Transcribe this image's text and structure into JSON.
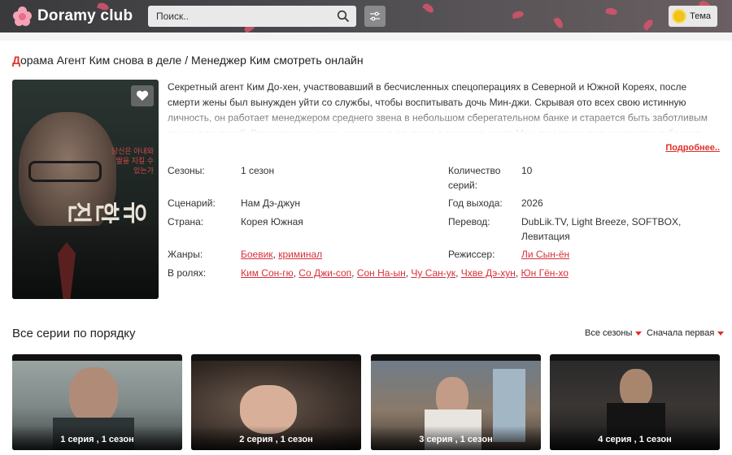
{
  "header": {
    "site_name": "Doramy club",
    "search_placeholder": "Поиск..",
    "theme_label": "Тема"
  },
  "page": {
    "title_first_letter": "Д",
    "title_rest": "орама Агент Ким снова в деле / Менеджер Ким смотреть онлайн",
    "description": "Секретный агент Ким До-хен, участвовавший в бесчисленных спецоперациях в Северной и Южной Кореях, после смерти жены был вынужден уйти со службы, чтобы воспитывать дочь Мин-джи. Скрывая ото всех свою истинную личность, он работает менеджером среднего звена в небольшом сберегательном банке и старается быть заботливым отцом-одиночкой. Размеренная жизнь мужчины в одночасье рушится, когда Мин-джи похищают неизвестные бандиты.",
    "more_link": "Подробнее..",
    "poster_text": "당신은 아내와 딸을 지킬 수 있는가"
  },
  "info": {
    "seasons_label": "Сезоны:",
    "seasons_value": "1 сезон",
    "episodes_label_1": "Количество",
    "episodes_label_2": "серий:",
    "episodes_value": "10",
    "writer_label": "Сценарий:",
    "writer_value": "Нам Дэ-джун",
    "year_label": "Год выхода:",
    "year_value": "2026",
    "country_label": "Страна:",
    "country_value": "Корея Южная",
    "translation_label": "Перевод:",
    "translation_value": "DubLik.TV, Light Breeze, SOFTBOX, Левитация",
    "genres_label": "Жанры:",
    "genres": [
      "Боевик",
      "криминал"
    ],
    "director_label": "Режиссер:",
    "director_value": "Ли Сын-ён",
    "cast_label": "В ролях:",
    "cast": [
      "Ким Сон-гю",
      "Со Джи-соп",
      "Сон На-ын",
      "Чу Сан-ук",
      "Чхве Дэ-хун",
      "Юн Гён-хо"
    ]
  },
  "episodes": {
    "heading": "Все серии по порядку",
    "season_filter": "Все сезоны",
    "order_filter": "Сначала первая",
    "items": [
      {
        "caption": "1 серия , 1 сезон"
      },
      {
        "caption": "2 серия , 1 сезон"
      },
      {
        "caption": "3 серия , 1 сезон"
      },
      {
        "caption": "4 серия , 1 сезон"
      }
    ]
  },
  "colors": {
    "accent": "#e0302a",
    "link": "#d6303a",
    "header_bg": "#4a4a4e"
  }
}
